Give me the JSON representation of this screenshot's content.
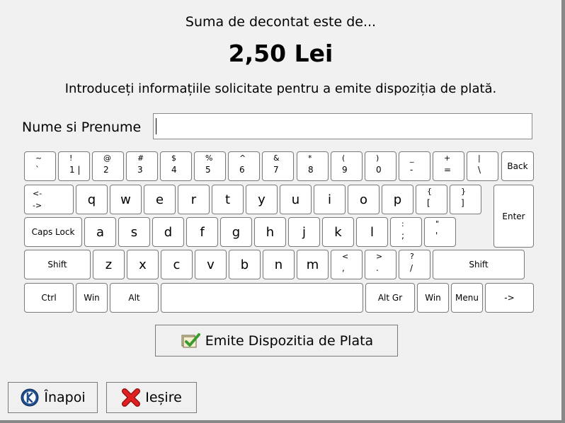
{
  "header": {
    "amount_prompt": "Suma de decontat este de...",
    "amount": "2,50 Lei",
    "instructions": "Introduceți informațiile solicitate pentru a emite dispoziția de plată."
  },
  "form": {
    "name_label": "Nume si Prenume",
    "name_value": ""
  },
  "keyboard": {
    "row1": [
      {
        "shift": "~",
        "main": "`"
      },
      {
        "shift": "!",
        "main": "1 |"
      },
      {
        "shift": "@",
        "main": "2"
      },
      {
        "shift": "#",
        "main": "3"
      },
      {
        "shift": "$",
        "main": "4"
      },
      {
        "shift": "%",
        "main": "5"
      },
      {
        "shift": "^",
        "main": "6"
      },
      {
        "shift": "&",
        "main": "7"
      },
      {
        "shift": "*",
        "main": "8"
      },
      {
        "shift": "(",
        "main": "9"
      },
      {
        "shift": ")",
        "main": "0"
      },
      {
        "shift": "_",
        "main": "-"
      },
      {
        "shift": "+",
        "main": "="
      },
      {
        "shift": "|",
        "main": "\\"
      }
    ],
    "backspace": "Back",
    "tab": {
      "top": "<-",
      "bottom": "->"
    },
    "row2_letters": [
      "q",
      "w",
      "e",
      "r",
      "t",
      "y",
      "u",
      "i",
      "o",
      "p"
    ],
    "row2_symbols": [
      {
        "shift": "{",
        "main": "["
      },
      {
        "shift": "}",
        "main": "]"
      }
    ],
    "enter": "Enter",
    "caps_lock": "Caps Lock",
    "row3_letters": [
      "a",
      "s",
      "d",
      "f",
      "g",
      "h",
      "j",
      "k",
      "l"
    ],
    "row3_symbols": [
      {
        "shift": ":",
        "main": ";"
      },
      {
        "shift": "\"",
        "main": "'"
      }
    ],
    "shift": "Shift",
    "row4_letters": [
      "z",
      "x",
      "c",
      "v",
      "b",
      "n",
      "m"
    ],
    "row4_symbols": [
      {
        "shift": "<",
        "main": ","
      },
      {
        "shift": ">",
        "main": "."
      },
      {
        "shift": "?",
        "main": "/"
      }
    ],
    "ctrl": "Ctrl",
    "win": "Win",
    "alt": "Alt",
    "alt_gr": "Alt Gr",
    "menu": "Menu",
    "arrow": "->"
  },
  "actions": {
    "issue_button": "Emite Dispozitia de Plata",
    "back_button": "Înapoi",
    "exit_button": "Ieșire"
  },
  "colors": {
    "background": "#f1f1f1",
    "key_face": "#ffffff",
    "key_border": "#7a7a7a",
    "exit_icon": "#e02020",
    "back_icon": "#1f4e8c",
    "issue_icon": "#3a9b2e"
  }
}
